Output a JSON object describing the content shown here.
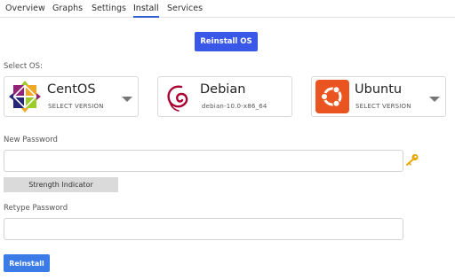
{
  "tabs": [
    {
      "label": "Overview"
    },
    {
      "label": "Graphs"
    },
    {
      "label": "Settings"
    },
    {
      "label": "Install"
    },
    {
      "label": "Services"
    }
  ],
  "active_tab": "Install",
  "top_button": {
    "label": "Reinstall OS"
  },
  "select_os_label": "Select OS:",
  "os_options": [
    {
      "name": "CentOS",
      "subtitle": "SELECT VERSION"
    },
    {
      "name": "Debian",
      "subtitle": "debian-10.0-x86_64"
    },
    {
      "name": "Ubuntu",
      "subtitle": "SELECT VERSION"
    }
  ],
  "new_password": {
    "label": "New Password",
    "value": ""
  },
  "strength": {
    "label": "Strength Indicator"
  },
  "retype_password": {
    "label": "Retype Password",
    "value": ""
  },
  "submit": {
    "label": "Reinstall"
  },
  "colors": {
    "primary": "#3a58e8",
    "submit": "#3a7be8",
    "ubuntu": "#e95420",
    "debian": "#a80030"
  }
}
